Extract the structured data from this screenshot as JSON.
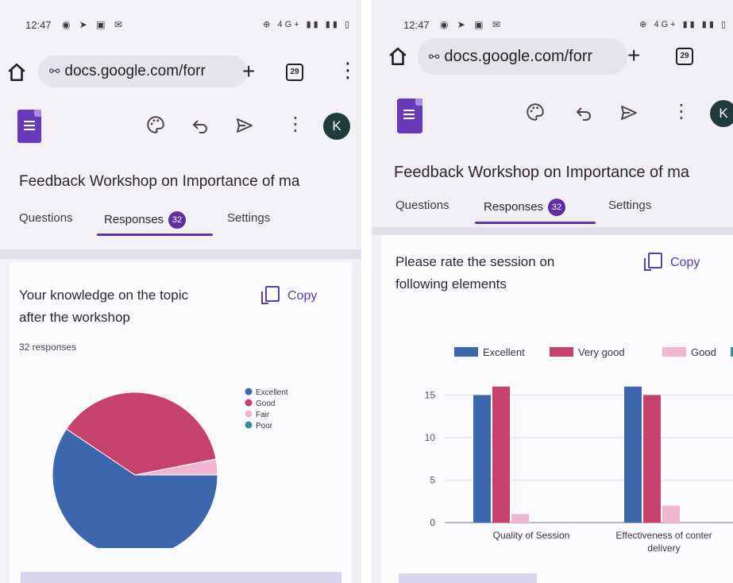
{
  "status_bar": {
    "time": "12:47",
    "notif_icons": [
      "whatsapp-icon",
      "telegram-icon",
      "gallery-icon",
      "gmail-icon"
    ],
    "right_icons_text": "4G+"
  },
  "browser": {
    "url": "docs.google.com/forr",
    "tab_count": "29"
  },
  "forms_toolbar": {
    "icons": [
      "palette-icon",
      "undo-icon",
      "send-icon",
      "more-vert-icon"
    ],
    "avatar_letter": "K"
  },
  "form": {
    "title": "Feedback  Workshop on Importance of ma",
    "tabs": [
      {
        "label": "Questions"
      },
      {
        "label": "Responses",
        "badge": "32",
        "active": true
      },
      {
        "label": "Settings"
      }
    ],
    "copy_label": "Copy"
  },
  "left_question": {
    "title_line1": "Your knowledge on the topic",
    "title_line2": "after the workshop",
    "responses": "32 responses"
  },
  "right_question": {
    "title_line1": "Please rate the session on",
    "title_line2": "following elements"
  },
  "chart_data": [
    {
      "type": "pie",
      "title": "Your knowledge on the topic after the workshop",
      "slices": [
        {
          "label": "Excellent",
          "value": 59.4,
          "color": "#3d67ad",
          "data_label": "59.4%"
        },
        {
          "label": "Good",
          "value": 37.5,
          "color": "#c6416d",
          "data_label": "37.5%"
        },
        {
          "label": "Fair",
          "value": 3.1,
          "color": "#f1b6d0"
        },
        {
          "label": "Poor",
          "value": 0,
          "color": "#3a8ca0"
        }
      ],
      "legend": "right"
    },
    {
      "type": "bar",
      "title": "Please rate the session on following elements",
      "categories": [
        "Quality of Session",
        "Effectiveness of conter delivery"
      ],
      "series": [
        {
          "name": "Excellent",
          "values": [
            15,
            16
          ],
          "color": "#3d67ad"
        },
        {
          "name": "Very good",
          "values": [
            16,
            15
          ],
          "color": "#c6416d"
        },
        {
          "name": "Good",
          "values": [
            1,
            2
          ],
          "color": "#f1b6d0"
        },
        {
          "name": "",
          "values": [
            0,
            0
          ],
          "color": "#3a8ca0"
        }
      ],
      "yticks": [
        "15",
        "10",
        "5",
        "0"
      ],
      "ylim": [
        0,
        17
      ],
      "legend": "top"
    }
  ]
}
